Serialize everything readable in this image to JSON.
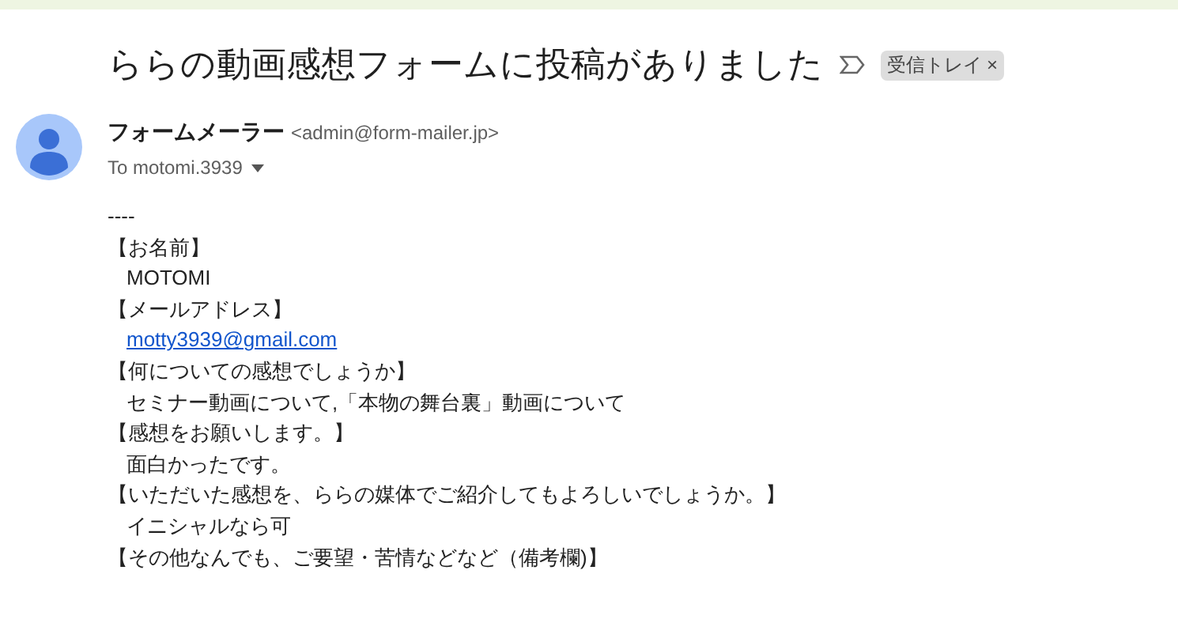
{
  "subject": "ららの動画感想フォームに投稿がありました",
  "label_tag": {
    "text": "受信トレイ",
    "close": "×"
  },
  "sender": {
    "name": "フォームメーラー",
    "address": "<admin@form-mailer.jp>"
  },
  "recipient": "To motomi.3939",
  "body": [
    {
      "kind": "plain",
      "text": "----"
    },
    {
      "kind": "heading",
      "text": "【お名前】"
    },
    {
      "kind": "value",
      "text": "MOTOMI"
    },
    {
      "kind": "heading",
      "text": "【メールアドレス】"
    },
    {
      "kind": "link",
      "text": "motty3939@gmail.com"
    },
    {
      "kind": "heading",
      "text": "【何についての感想でしょうか】"
    },
    {
      "kind": "value",
      "text": "セミナー動画について,「本物の舞台裏」動画について"
    },
    {
      "kind": "heading",
      "text": "【感想をお願いします。】"
    },
    {
      "kind": "value",
      "text": "面白かったです。"
    },
    {
      "kind": "heading",
      "text": "【いただいた感想を、ららの媒体でご紹介してもよろしいでしょうか。】"
    },
    {
      "kind": "value",
      "text": "イニシャルなら可"
    },
    {
      "kind": "heading",
      "text": "【その他なんでも、ご要望・苦情などなど（備考欄)】"
    }
  ]
}
